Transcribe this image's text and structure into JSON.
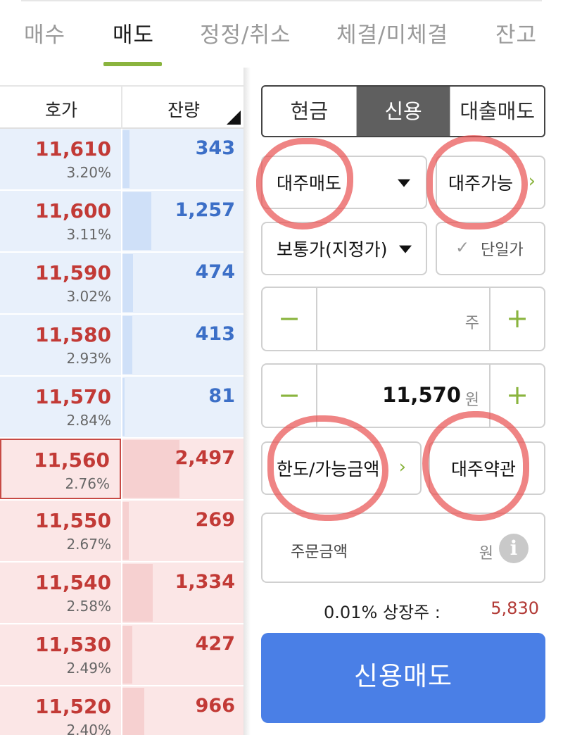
{
  "tabs": [
    {
      "label": "매수"
    },
    {
      "label": "매도"
    },
    {
      "label": "정정/취소"
    },
    {
      "label": "체결/미체결"
    },
    {
      "label": "잔고"
    }
  ],
  "active_tab": "매도",
  "orderbook": {
    "headers": {
      "price": "호가",
      "volume": "잔량"
    },
    "rows": [
      {
        "side": "ask",
        "price": "11,610",
        "pct": "3.20%",
        "volume": "343",
        "bar_fraction": 0.06
      },
      {
        "side": "ask",
        "price": "11,600",
        "pct": "3.11%",
        "volume": "1,257",
        "bar_fraction": 0.24
      },
      {
        "side": "ask",
        "price": "11,590",
        "pct": "3.02%",
        "volume": "474",
        "bar_fraction": 0.09
      },
      {
        "side": "ask",
        "price": "11,580",
        "pct": "2.93%",
        "volume": "413",
        "bar_fraction": 0.08
      },
      {
        "side": "ask",
        "price": "11,570",
        "pct": "2.84%",
        "volume": "81",
        "bar_fraction": 0.02
      },
      {
        "side": "bid",
        "price": "11,560",
        "pct": "2.76%",
        "volume": "2,497",
        "bar_fraction": 0.47,
        "current": true
      },
      {
        "side": "bid",
        "price": "11,550",
        "pct": "2.67%",
        "volume": "269",
        "bar_fraction": 0.05
      },
      {
        "side": "bid",
        "price": "11,540",
        "pct": "2.58%",
        "volume": "1,334",
        "bar_fraction": 0.25
      },
      {
        "side": "bid",
        "price": "11,530",
        "pct": "2.49%",
        "volume": "427",
        "bar_fraction": 0.08
      },
      {
        "side": "bid",
        "price": "11,520",
        "pct": "2.40%",
        "volume": "966",
        "bar_fraction": 0.18
      }
    ]
  },
  "order_type_segment": {
    "options": [
      "현금",
      "신용",
      "대출매도"
    ],
    "selected": "신용"
  },
  "loan_type": {
    "label": "대주매도"
  },
  "loan_available": {
    "label": "대주가능"
  },
  "price_type": {
    "label": "보통가(지정가)"
  },
  "single_price": {
    "label": "단일가",
    "checked": false
  },
  "quantity": {
    "value": "",
    "unit": "주"
  },
  "price": {
    "value": "11,570",
    "unit": "원"
  },
  "limit_button": {
    "label": "한도/가능금액"
  },
  "terms_button": {
    "label": "대주약관"
  },
  "order_amount": {
    "label": "주문금액",
    "unit": "원"
  },
  "listed_shares": {
    "label": "0.01% 상장주 :",
    "value": "5,830"
  },
  "submit": {
    "label": "신용매도"
  },
  "colors": {
    "accent_green": "#8ab43e",
    "ask_blue": "#3c6fc7",
    "bid_red": "#c23a36",
    "submit_blue": "#4a7fe6",
    "annotation_red": "#e85050"
  }
}
